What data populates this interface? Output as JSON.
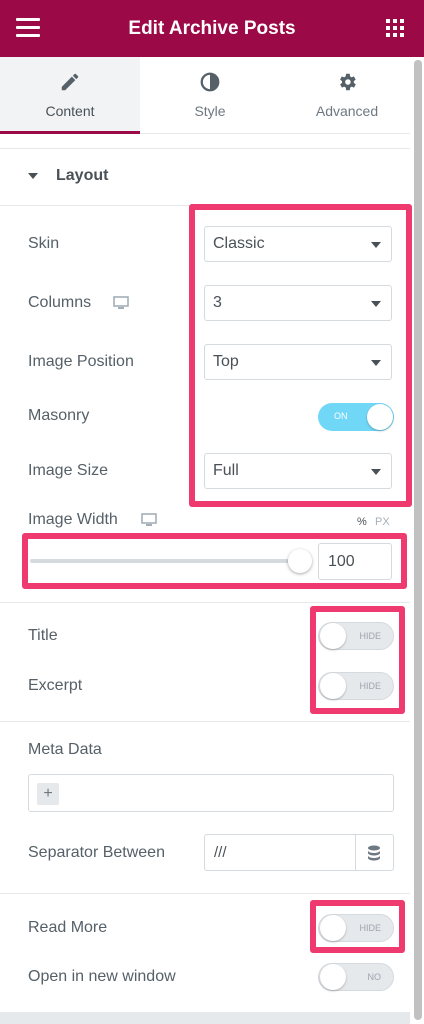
{
  "header": {
    "title": "Edit Archive Posts",
    "menu_icon": "hamburger-icon",
    "apps_icon": "grid-icon",
    "color": "#9b0a46"
  },
  "tabs": [
    {
      "label": "Content",
      "icon": "pencil-icon",
      "active": true
    },
    {
      "label": "Style",
      "icon": "half-circle-icon",
      "active": false
    },
    {
      "label": "Advanced",
      "icon": "gear-icon",
      "active": false
    }
  ],
  "layout": {
    "section_label": "Layout",
    "skin": {
      "label": "Skin",
      "value": "Classic"
    },
    "columns": {
      "label": "Columns",
      "value": "3"
    },
    "image_position": {
      "label": "Image Position",
      "value": "Top"
    },
    "masonry": {
      "label": "Masonry",
      "state": "ON"
    },
    "image_size": {
      "label": "Image Size",
      "value": "Full"
    },
    "image_width": {
      "label": "Image Width",
      "unit_percent": "%",
      "unit_px": "PX",
      "value": "100",
      "level": 1.0
    },
    "title": {
      "label": "Title",
      "state": "HIDE"
    },
    "excerpt": {
      "label": "Excerpt",
      "state": "HIDE"
    },
    "meta_data": {
      "label": "Meta Data",
      "add_symbol": "+"
    },
    "separator": {
      "label": "Separator Between",
      "value": "///"
    },
    "read_more": {
      "label": "Read More",
      "state": "HIDE"
    },
    "new_window": {
      "label": "Open in new window",
      "state": "NO"
    }
  },
  "colors": {
    "accent": "#9b0a46",
    "highlight": "#ef3a6f",
    "toggle_on": "#71d7f7"
  }
}
